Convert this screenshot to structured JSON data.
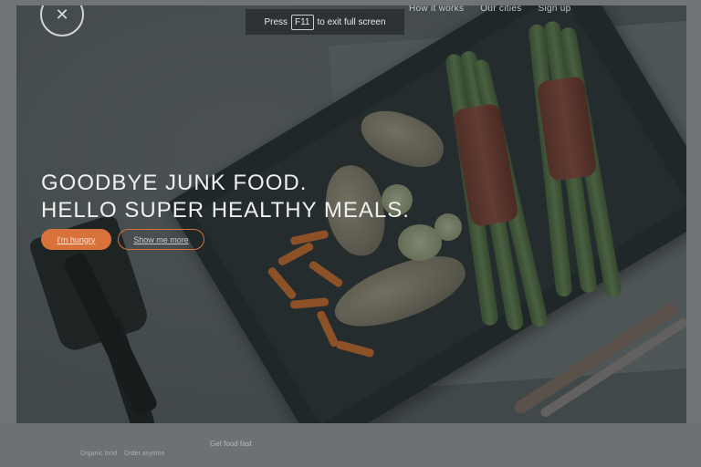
{
  "nav": {
    "links": [
      "How it works",
      "Our cities",
      "Sign up"
    ]
  },
  "fullscreen_notice": {
    "prefix": "Press",
    "key": "F11",
    "suffix": "to exit full screen"
  },
  "hero": {
    "headline_line1": "GOODBYE JUNK FOOD.",
    "headline_line2": "HELLO SUPER HEALTHY MEALS.",
    "primary_button": "I'm hungry",
    "secondary_button": "Show me more"
  },
  "below": {
    "items": [
      "Organic food",
      "Order anytime"
    ],
    "section_label": "Get food fast"
  },
  "colors": {
    "accent": "#d9713a"
  },
  "icons": {
    "logo": "fork-knife-icon"
  }
}
